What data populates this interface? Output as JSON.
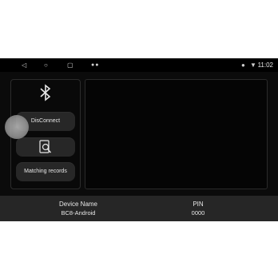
{
  "status_bar": {
    "icons": [
      "back-icon",
      "home-icon",
      "recent-apps-icon",
      "notification-icon",
      "location-icon",
      "wifi-icon"
    ],
    "time": "11:02"
  },
  "bluetooth_panel": {
    "icon": "bluetooth-icon",
    "disconnect_label": "DisConnect",
    "search_icon": "search-device-icon",
    "matching_records_label": "Matching records"
  },
  "device_info": {
    "device_name_label": "Device Name",
    "device_name_value": "BC8-Android",
    "pin_label": "PIN",
    "pin_value": "0000"
  },
  "colors": {
    "background": "#0b0b0b",
    "button": "#272727",
    "info_bar": "#262626",
    "text": "#e6e6e6"
  }
}
